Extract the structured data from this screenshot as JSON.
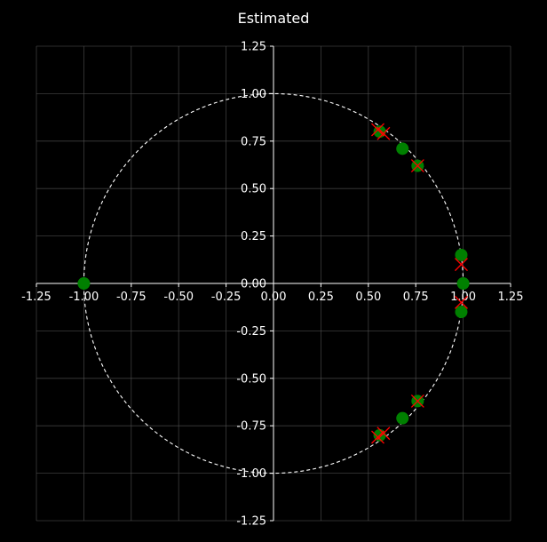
{
  "chart_data": {
    "type": "scatter",
    "title": "Estimated",
    "xlabel": "",
    "ylabel": "",
    "xlim": [
      -1.25,
      1.25
    ],
    "ylim": [
      -1.25,
      1.25
    ],
    "xticks": [
      "-1.25",
      "-1.00",
      "-0.75",
      "-0.50",
      "-0.25",
      "0.00",
      "0.25",
      "0.50",
      "0.75",
      "1.00",
      "1.25"
    ],
    "yticks": [
      "1.25",
      "1.00",
      "0.75",
      "0.50",
      "0.25",
      "0.00",
      "-0.25",
      "-0.50",
      "-0.75",
      "-1.00",
      "-1.25"
    ],
    "grid": true,
    "unit_circle": true,
    "colors": {
      "background": "#000000",
      "zeros": "#008000",
      "poles": "#ff0000",
      "grid": "#555555",
      "axes": "#ffffff",
      "circle": "#ffffff"
    },
    "series": [
      {
        "marker": "circle",
        "x": [
          0.56,
          0.68,
          0.76,
          0.99,
          1.0,
          0.99,
          0.76,
          0.68,
          0.56,
          -1.0
        ],
        "y": [
          0.8,
          0.71,
          0.62,
          0.15,
          0.0,
          -0.15,
          -0.62,
          -0.71,
          -0.8,
          0.0
        ]
      },
      {
        "marker": "x",
        "x": [
          0.55,
          0.58,
          0.76,
          0.99,
          0.99,
          0.76,
          0.58,
          0.55
        ],
        "y": [
          0.81,
          0.79,
          0.62,
          0.1,
          -0.1,
          -0.62,
          -0.79,
          -0.81
        ]
      }
    ]
  }
}
